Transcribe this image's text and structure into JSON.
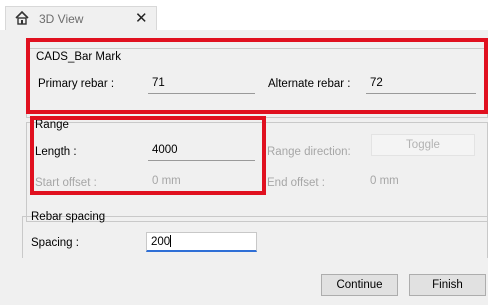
{
  "tab": {
    "title": "3D View",
    "home_icon": "home-icon",
    "close_glyph": "✕"
  },
  "bar_mark": {
    "title": "CADS_Bar Mark",
    "primary_label": "Primary rebar :",
    "primary_value": "71",
    "alternate_label": "Alternate rebar :",
    "alternate_value": "72"
  },
  "range": {
    "title": "Range",
    "length_label": "Length :",
    "length_value": "4000",
    "direction_label": "Range direction:",
    "toggle_label": "Toggle",
    "start_offset_label": "Start offset :",
    "start_offset_value": "0 mm",
    "end_offset_label": "End offset :",
    "end_offset_value": "0 mm"
  },
  "spacing": {
    "title": "Rebar spacing",
    "spacing_label": "Spacing :",
    "spacing_value": "200"
  },
  "buttons": {
    "continue": "Continue",
    "finish": "Finish"
  },
  "colors": {
    "highlight": "#e0101f",
    "focus": "#2f6fd6"
  }
}
